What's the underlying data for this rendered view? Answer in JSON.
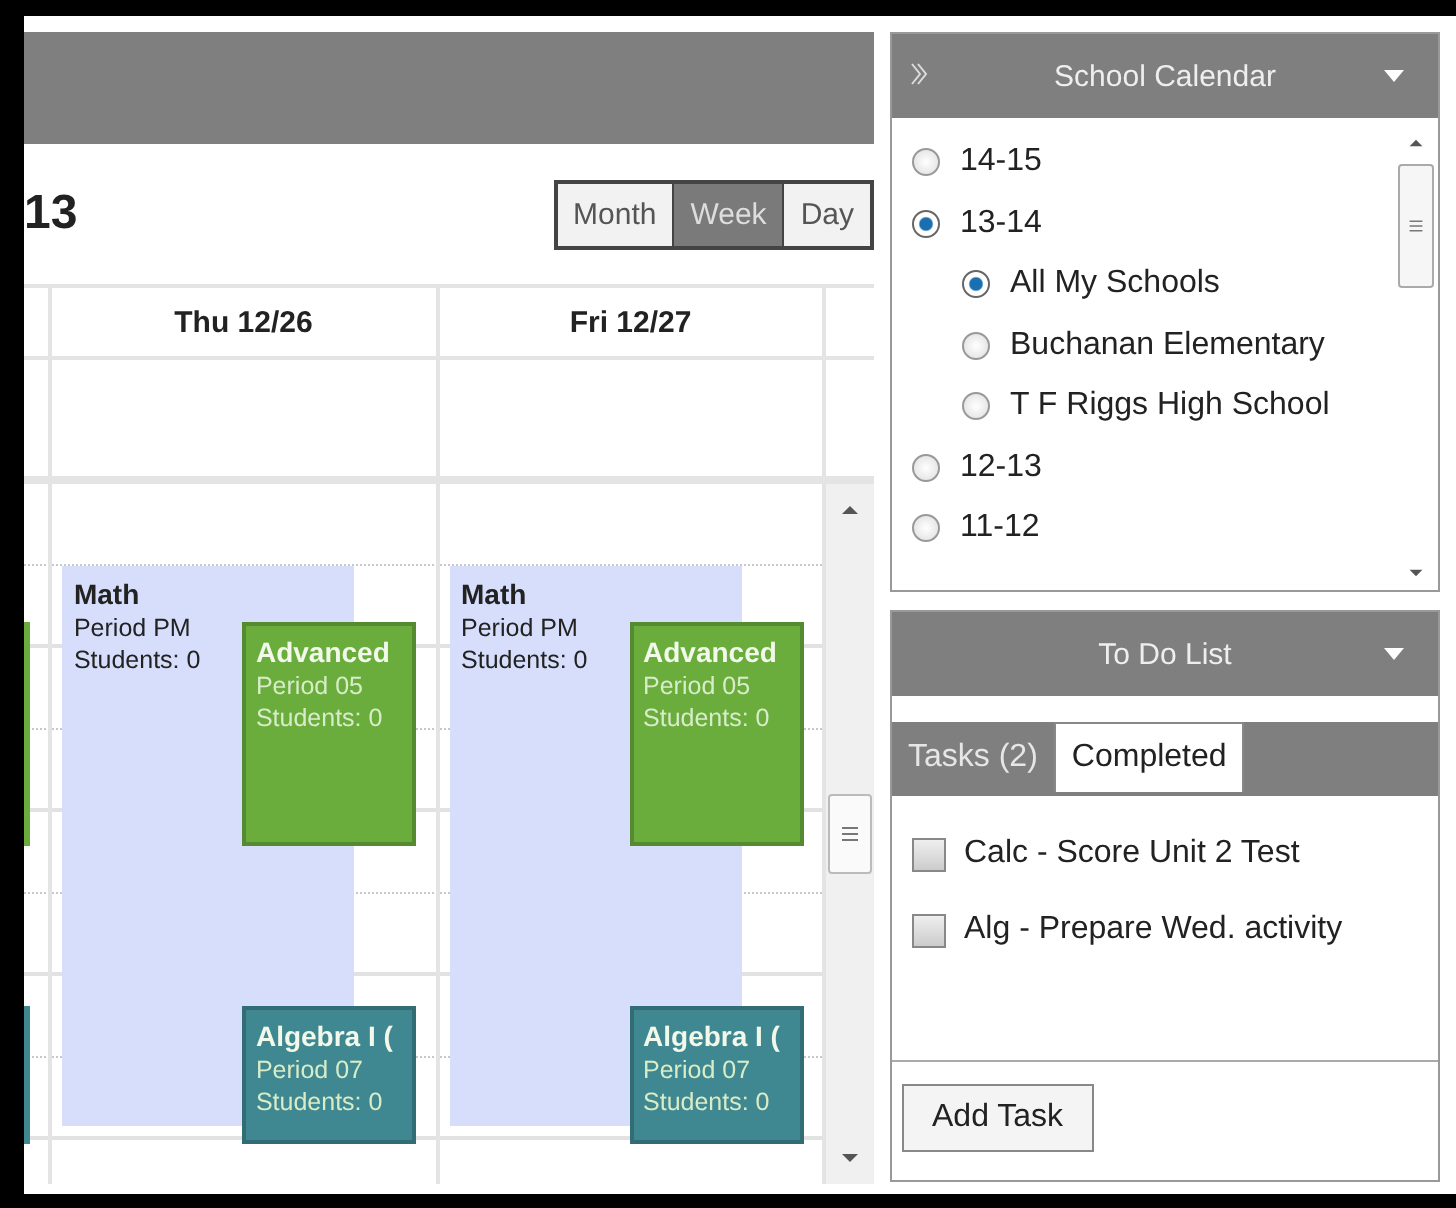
{
  "calendar": {
    "title_fragment": "13",
    "views": [
      {
        "label": "Month",
        "selected": false
      },
      {
        "label": "Week",
        "selected": true
      },
      {
        "label": "Day",
        "selected": false
      }
    ],
    "partial_day": {
      "events": [
        {
          "color": "#6aad3d"
        },
        {
          "color": "#3f8891"
        }
      ]
    },
    "days": [
      {
        "label": "Thu 12/26",
        "events": [
          {
            "title": "Math",
            "lines": [
              "Period PM",
              "Students: 0"
            ],
            "color": "#d6defb"
          },
          {
            "title": "Advanced",
            "lines": [
              "Period 05",
              "Students: 0"
            ],
            "color": "#6aad3d"
          },
          {
            "title": "Algebra I (",
            "lines": [
              "Period 07",
              "Students: 0"
            ],
            "color": "#3f8891"
          }
        ]
      },
      {
        "label": "Fri 12/27",
        "events": [
          {
            "title": "Math",
            "lines": [
              "Period PM",
              "Students: 0"
            ],
            "color": "#d6defb"
          },
          {
            "title": "Advanced",
            "lines": [
              "Period 05",
              "Students: 0"
            ],
            "color": "#6aad3d"
          },
          {
            "title": "Algebra I (",
            "lines": [
              "Period 07",
              "Students: 0"
            ],
            "color": "#3f8891"
          }
        ]
      }
    ]
  },
  "school_calendar": {
    "title": "School Calendar",
    "items": [
      {
        "label": "14-15",
        "selected": false
      },
      {
        "label": "13-14",
        "selected": true,
        "children": [
          {
            "label": "All My Schools",
            "selected": true
          },
          {
            "label": "Buchanan Elementary",
            "selected": false
          },
          {
            "label": "T F Riggs High School",
            "selected": false
          }
        ]
      },
      {
        "label": "12-13",
        "selected": false
      },
      {
        "label": "11-12",
        "selected": false
      }
    ]
  },
  "todo": {
    "title": "To Do List",
    "tabs": [
      {
        "label": "Tasks (2)",
        "selected": true
      },
      {
        "label": "Completed",
        "selected": false
      }
    ],
    "tasks": [
      {
        "label": "Calc - Score Unit 2 Test",
        "checked": false
      },
      {
        "label": "Alg - Prepare Wed. activity",
        "checked": false
      }
    ],
    "add_button": "Add Task"
  }
}
